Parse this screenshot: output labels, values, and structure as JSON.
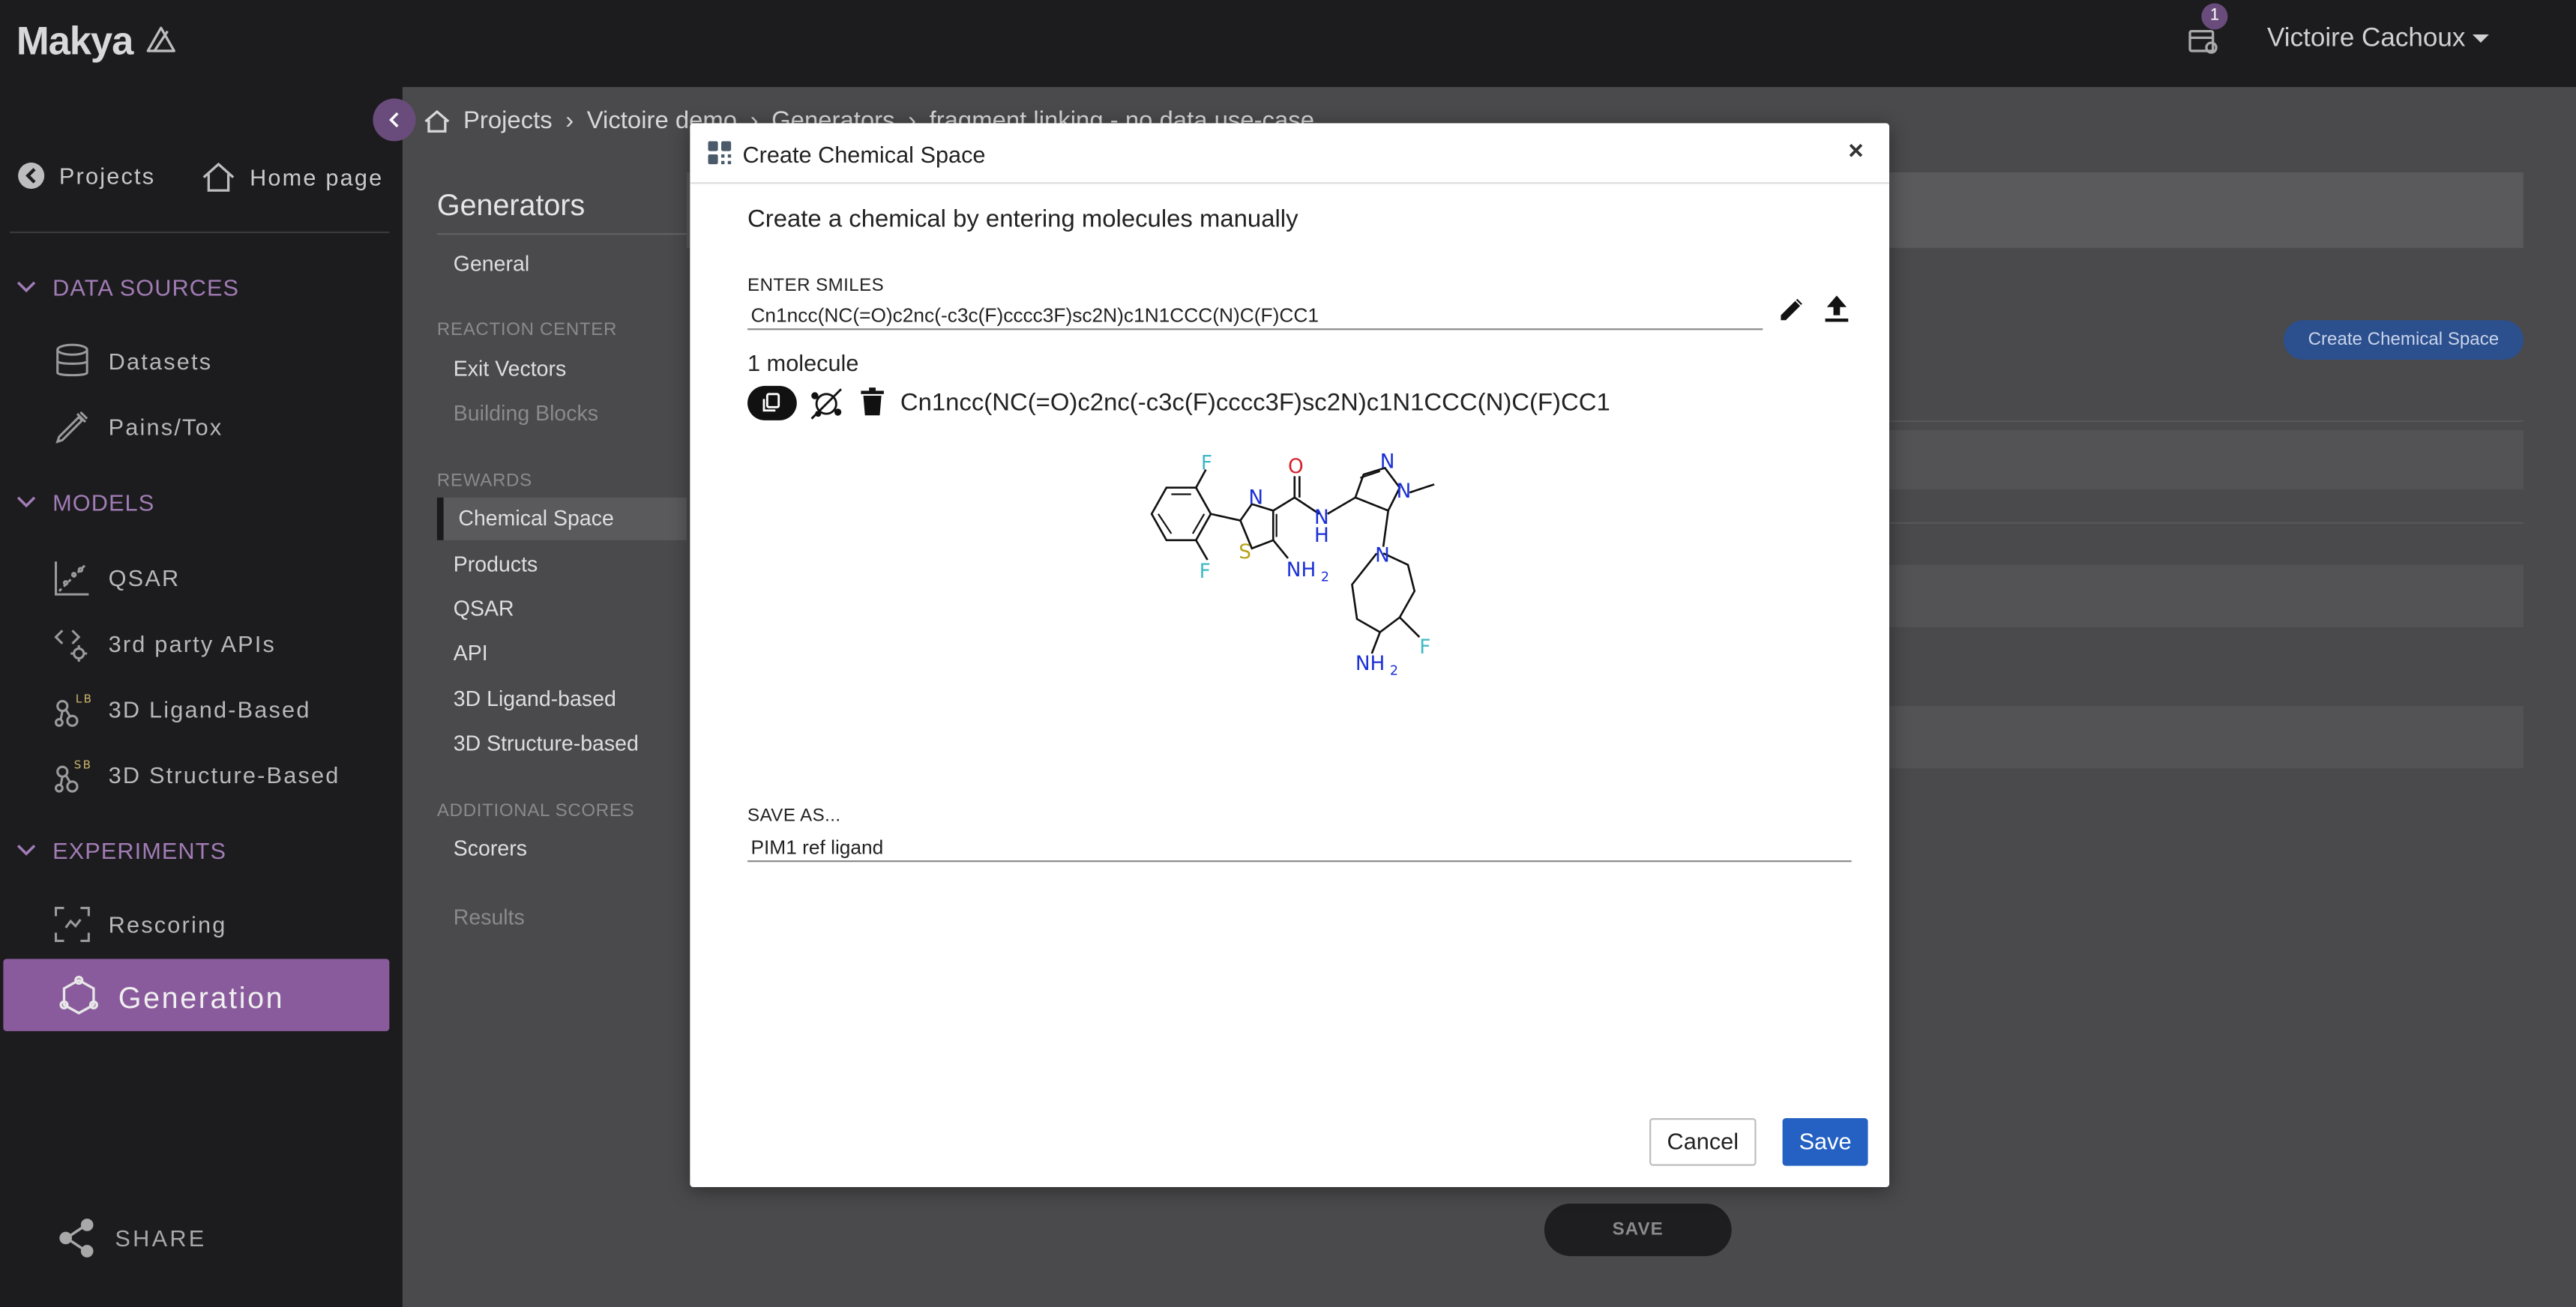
{
  "app": {
    "logo": "Makya",
    "notification_count": "1",
    "user_name": "Victoire Cachoux"
  },
  "sidebar": {
    "top_links": [
      {
        "label": "Projects",
        "icon": "arrow-left-circle-icon"
      },
      {
        "label": "Home page",
        "icon": "home-icon"
      }
    ],
    "sections": [
      {
        "label": "DATA SOURCES",
        "items": [
          {
            "label": "Datasets",
            "icon": "database-icon"
          },
          {
            "label": "Pains/Tox",
            "icon": "pipette-icon"
          }
        ]
      },
      {
        "label": "MODELS",
        "items": [
          {
            "label": "QSAR",
            "icon": "scatter-icon"
          },
          {
            "label": "3rd party APIs",
            "icon": "code-gear-icon"
          },
          {
            "label": "3D Ligand-Based",
            "icon": "molecule-lb-icon"
          },
          {
            "label": "3D Structure-Based",
            "icon": "molecule-sb-icon"
          }
        ]
      },
      {
        "label": "EXPERIMENTS",
        "items": [
          {
            "label": "Rescoring",
            "icon": "rescoring-icon"
          },
          {
            "label": "Generation",
            "icon": "hexagon-molecule-icon"
          }
        ]
      }
    ],
    "share_label": "SHARE"
  },
  "breadcrumb": {
    "items": [
      "Projects",
      "Victoire demo",
      "Generators",
      "fragment linking - no data use-case"
    ]
  },
  "generators_panel": {
    "title": "Generators",
    "general": "General",
    "reaction_center_heading": "REACTION CENTER",
    "exit_vectors": "Exit Vectors",
    "building_blocks": "Building Blocks",
    "rewards_heading": "REWARDS",
    "rewards": [
      "Chemical Space",
      "Products",
      "QSAR",
      "API",
      "3D Ligand-based",
      "3D Structure-based"
    ],
    "additional_scores_heading": "ADDITIONAL SCORES",
    "scorers": "Scorers",
    "results": "Results"
  },
  "main": {
    "create_chemical_space_button": "Create Chemical Space",
    "save_button": "SAVE"
  },
  "modal": {
    "title": "Create Chemical Space",
    "close": "×",
    "heading": "Create a chemical by entering molecules manually",
    "smiles_label": "ENTER SMILES",
    "smiles_value": "Cn1ncc(NC(=O)c2nc(-c3c(F)cccc3F)sc2N)c1N1CCC(N)C(F)CC1",
    "molecule_count": "1 molecule",
    "molecule_smiles": "Cn1ncc(NC(=O)c2nc(-c3c(F)cccc3F)sc2N)c1N1CCC(N)C(F)CC1",
    "save_as_label": "SAVE AS...",
    "save_as_value": "PIM1 ref ligand",
    "cancel_label": "Cancel",
    "save_label": "Save",
    "structure_atoms": {
      "fluorine": "F",
      "nitrogen": "N",
      "oxygen": "O",
      "sulfur": "S",
      "amine": "NH",
      "amine_sub": "2",
      "amide_nh": "H"
    }
  },
  "colors": {
    "accent_purple": "#8a5b9c",
    "section_purple": "#a27cb5",
    "save_blue": "#2461c3",
    "badge": "#6a4c7c"
  }
}
